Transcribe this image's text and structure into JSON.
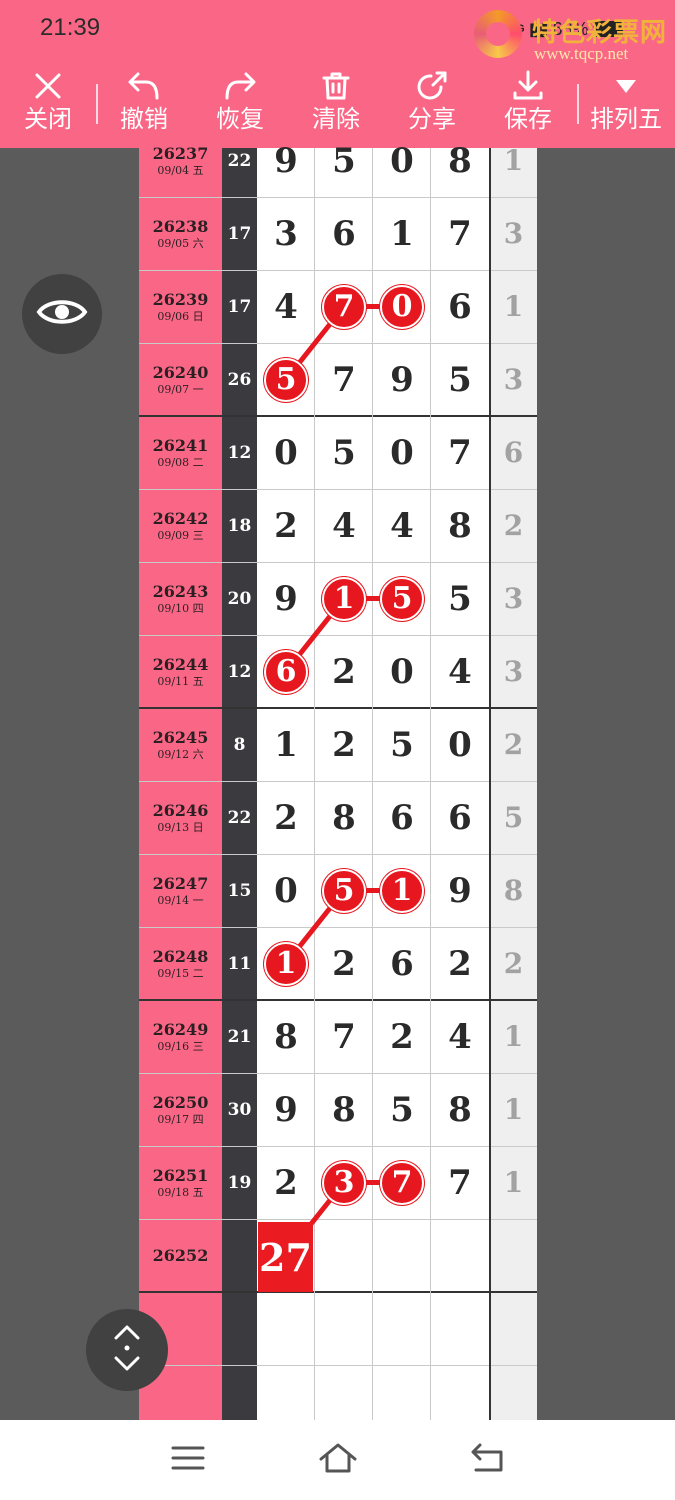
{
  "status_bar": {
    "time": "21:39",
    "network": "5G",
    "battery": "68%"
  },
  "watermark": {
    "title": "特色彩票网",
    "url": "www.tqcp.net"
  },
  "toolbar": {
    "items": [
      {
        "label": "关闭",
        "icon": "close-icon"
      },
      {
        "label": "撤销",
        "icon": "undo-icon"
      },
      {
        "label": "恢复",
        "icon": "redo-icon"
      },
      {
        "label": "清除",
        "icon": "trash-icon"
      },
      {
        "label": "分享",
        "icon": "share-icon"
      },
      {
        "label": "保存",
        "icon": "download-icon"
      },
      {
        "label": "排列五",
        "icon": "triangle-down-icon"
      }
    ]
  },
  "table": {
    "rows": [
      {
        "period": "26237",
        "date": "09/04 五",
        "sum": "22",
        "d1": "9",
        "d2": "5",
        "d3": "0",
        "d4": "8",
        "extra": "1"
      },
      {
        "period": "26238",
        "date": "09/05 六",
        "sum": "17",
        "d1": "3",
        "d2": "6",
        "d3": "1",
        "d4": "7",
        "extra": "3"
      },
      {
        "period": "26239",
        "date": "09/06 日",
        "sum": "17",
        "d1": "4",
        "d2": "7",
        "d3": "0",
        "d4": "6",
        "extra": "1"
      },
      {
        "period": "26240",
        "date": "09/07 一",
        "sum": "26",
        "d1": "5",
        "d2": "7",
        "d3": "9",
        "d4": "5",
        "extra": "3"
      },
      {
        "period": "26241",
        "date": "09/08 二",
        "sum": "12",
        "d1": "0",
        "d2": "5",
        "d3": "0",
        "d4": "7",
        "extra": "6"
      },
      {
        "period": "26242",
        "date": "09/09 三",
        "sum": "18",
        "d1": "2",
        "d2": "4",
        "d3": "4",
        "d4": "8",
        "extra": "2"
      },
      {
        "period": "26243",
        "date": "09/10 四",
        "sum": "20",
        "d1": "9",
        "d2": "1",
        "d3": "5",
        "d4": "5",
        "extra": "3"
      },
      {
        "period": "26244",
        "date": "09/11 五",
        "sum": "12",
        "d1": "6",
        "d2": "2",
        "d3": "0",
        "d4": "4",
        "extra": "3"
      },
      {
        "period": "26245",
        "date": "09/12 六",
        "sum": "8",
        "d1": "1",
        "d2": "2",
        "d3": "5",
        "d4": "0",
        "extra": "2"
      },
      {
        "period": "26246",
        "date": "09/13 日",
        "sum": "22",
        "d1": "2",
        "d2": "8",
        "d3": "6",
        "d4": "6",
        "extra": "5"
      },
      {
        "period": "26247",
        "date": "09/14 一",
        "sum": "15",
        "d1": "0",
        "d2": "5",
        "d3": "1",
        "d4": "9",
        "extra": "8"
      },
      {
        "period": "26248",
        "date": "09/15 二",
        "sum": "11",
        "d1": "1",
        "d2": "2",
        "d3": "6",
        "d4": "2",
        "extra": "2"
      },
      {
        "period": "26249",
        "date": "09/16 三",
        "sum": "21",
        "d1": "8",
        "d2": "7",
        "d3": "2",
        "d4": "4",
        "extra": "1"
      },
      {
        "period": "26250",
        "date": "09/17 四",
        "sum": "30",
        "d1": "9",
        "d2": "8",
        "d3": "5",
        "d4": "8",
        "extra": "1"
      },
      {
        "period": "26251",
        "date": "09/18 五",
        "sum": "19",
        "d1": "2",
        "d2": "3",
        "d3": "7",
        "d4": "7",
        "extra": "1"
      },
      {
        "period": "26252",
        "date": "",
        "sum": "",
        "d1": "",
        "d2": "",
        "d3": "",
        "d4": "",
        "extra": ""
      },
      {
        "period": "",
        "date": "",
        "sum": "",
        "d1": "",
        "d2": "",
        "d3": "",
        "d4": "",
        "extra": ""
      },
      {
        "period": "",
        "date": "",
        "sum": "",
        "d1": "",
        "d2": "",
        "d3": "",
        "d4": "",
        "extra": ""
      }
    ],
    "circled": [
      {
        "row": 2,
        "col": 2,
        "value": "7"
      },
      {
        "row": 2,
        "col": 3,
        "value": "0"
      },
      {
        "row": 3,
        "col": 1,
        "value": "5"
      },
      {
        "row": 6,
        "col": 2,
        "value": "1"
      },
      {
        "row": 6,
        "col": 3,
        "value": "5"
      },
      {
        "row": 7,
        "col": 1,
        "value": "6"
      },
      {
        "row": 10,
        "col": 2,
        "value": "5"
      },
      {
        "row": 10,
        "col": 3,
        "value": "1"
      },
      {
        "row": 11,
        "col": 1,
        "value": "1"
      },
      {
        "row": 14,
        "col": 2,
        "value": "3"
      },
      {
        "row": 14,
        "col": 3,
        "value": "7"
      }
    ],
    "highlight_value": "27"
  },
  "floating_buttons": [
    {
      "name": "eye-toggle-button",
      "icon": "eye-icon"
    },
    {
      "name": "scroll-toggle-button",
      "icon": "up-down-chevron-icon"
    }
  ],
  "nav_bar": {
    "icons": [
      "menu-icon",
      "home-icon",
      "back-icon"
    ]
  },
  "colors": {
    "accent": "#fa6786",
    "dark_column": "#3b3a3e",
    "highlight": "#e6171e",
    "muted": "#a2a2a2"
  }
}
